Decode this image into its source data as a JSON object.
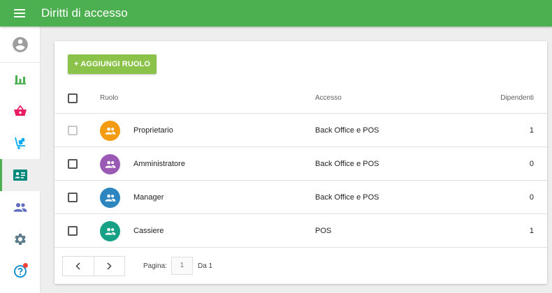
{
  "header": {
    "title": "Diritti di accesso"
  },
  "toolbar": {
    "add_role_label": "+ AGGIUNGI RUOLO"
  },
  "table": {
    "columns": {
      "role": "Ruolo",
      "access": "Accesso",
      "employees": "Dipendenti"
    },
    "rows": [
      {
        "name": "Proprietario",
        "access": "Back Office e POS",
        "employees": "1",
        "avatar_color": "#f39c12",
        "checkbox_disabled": true
      },
      {
        "name": "Amministratore",
        "access": "Back Office e POS",
        "employees": "0",
        "avatar_color": "#9b59b6",
        "checkbox_disabled": false
      },
      {
        "name": "Manager",
        "access": "Back Office e POS",
        "employees": "0",
        "avatar_color": "#2e86c1",
        "checkbox_disabled": false
      },
      {
        "name": "Cassiere",
        "access": "POS",
        "employees": "1",
        "avatar_color": "#16a085",
        "checkbox_disabled": false
      }
    ]
  },
  "pagination": {
    "page_label": "Pagina:",
    "current_page": "1",
    "of_label": "Da 1"
  },
  "sidebar": {
    "items": [
      {
        "icon": "account-circle-icon",
        "color": "#9e9e9e"
      },
      {
        "icon": "bar-chart-icon",
        "color": "#4caf50"
      },
      {
        "icon": "shopping-basket-icon",
        "color": "#e91e63"
      },
      {
        "icon": "inventory-cart-icon",
        "color": "#03a9f4"
      },
      {
        "icon": "employee-badge-icon",
        "color": "#00897b",
        "active": true
      },
      {
        "icon": "customers-icon",
        "color": "#5c6bc0"
      },
      {
        "icon": "settings-icon",
        "color": "#607d8b"
      },
      {
        "icon": "help-icon",
        "color": "#0288d1",
        "badge": true
      }
    ]
  },
  "colors": {
    "accent": "#4caf50",
    "add_button": "#8bc34a",
    "notification": "#f44336"
  }
}
